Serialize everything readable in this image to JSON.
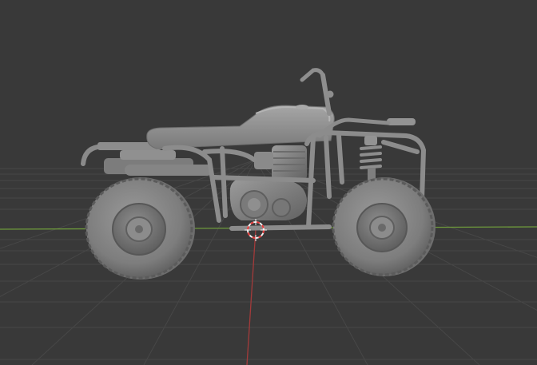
{
  "viewport": {
    "background": "#393939",
    "grid_color": "#474747",
    "x_axis_color": "#6e9a3c",
    "y_axis_color": "#a33a3a",
    "cursor_colors": [
      "#e63a3a",
      "#f2f2f2"
    ]
  },
  "model": {
    "object": "atv-quad-bike",
    "shading": "solid",
    "base_color": "#8e8e8e"
  },
  "icons": {
    "cursor": "3d-cursor-icon"
  }
}
